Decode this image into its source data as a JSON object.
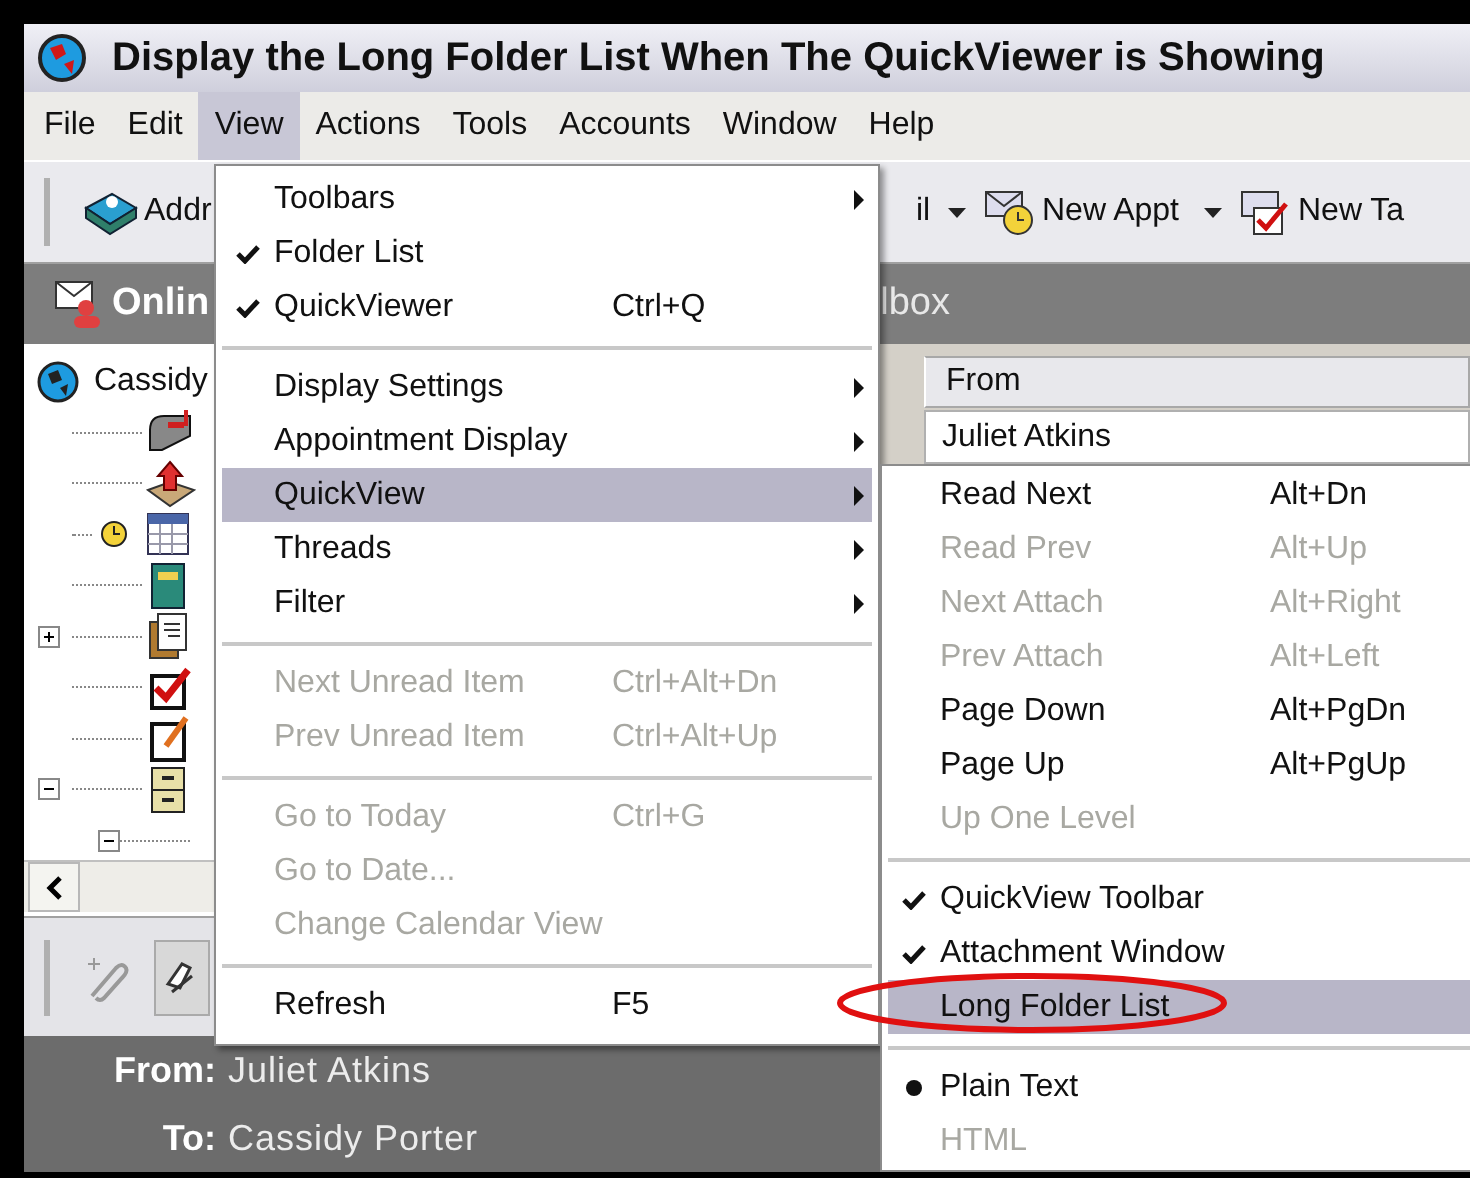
{
  "window": {
    "title": "Display the Long Folder List When The QuickViewer is Showing"
  },
  "menu_bar": [
    {
      "label": "File",
      "selected": false
    },
    {
      "label": "Edit",
      "selected": false
    },
    {
      "label": "View",
      "selected": true
    },
    {
      "label": "Actions",
      "selected": false
    },
    {
      "label": "Tools",
      "selected": false
    },
    {
      "label": "Accounts",
      "selected": false
    },
    {
      "label": "Window",
      "selected": false
    },
    {
      "label": "Help",
      "selected": false
    }
  ],
  "toolbar": [
    {
      "kind": "address",
      "label": "Addr"
    },
    {
      "kind": "mail",
      "label": "il"
    },
    {
      "kind": "appointment",
      "label": "New Appt"
    },
    {
      "kind": "task",
      "label": "New Ta"
    }
  ],
  "panel_header": {
    "title": "Onlin",
    "subtitle": "lbox"
  },
  "folder_tree": {
    "root": "Cassidy",
    "children": [
      {
        "kind": "mailbox"
      },
      {
        "kind": "outbox"
      },
      {
        "kind": "calendar"
      },
      {
        "kind": "notebook"
      },
      {
        "kind": "document",
        "expanded": false
      },
      {
        "kind": "checklist"
      },
      {
        "kind": "note"
      },
      {
        "kind": "cabinet",
        "expanded": true,
        "children": [
          {
            "expanded": true
          }
        ]
      }
    ]
  },
  "message_list": {
    "columns": [
      "From"
    ],
    "rows": [
      [
        "Juliet Atkins"
      ]
    ]
  },
  "view_menu": [
    {
      "kind": "submenu",
      "label": "Toolbars",
      "disabled": false,
      "selected": false
    },
    {
      "kind": "check",
      "label": "Folder List",
      "checked": true,
      "disabled": false,
      "selected": false
    },
    {
      "kind": "check",
      "label": "QuickViewer",
      "shortcut": "Ctrl+Q",
      "checked": true,
      "disabled": false,
      "selected": false
    },
    {
      "kind": "separator"
    },
    {
      "kind": "submenu",
      "label": "Display Settings",
      "disabled": false,
      "selected": false
    },
    {
      "kind": "submenu",
      "label": "Appointment Display",
      "disabled": false,
      "selected": false
    },
    {
      "kind": "submenu",
      "label": "QuickView",
      "disabled": false,
      "selected": true
    },
    {
      "kind": "submenu",
      "label": "Threads",
      "disabled": false,
      "selected": false
    },
    {
      "kind": "submenu",
      "label": "Filter",
      "disabled": false,
      "selected": false
    },
    {
      "kind": "separator"
    },
    {
      "kind": "command",
      "label": "Next Unread Item",
      "shortcut": "Ctrl+Alt+Dn",
      "disabled": true,
      "selected": false
    },
    {
      "kind": "command",
      "label": "Prev Unread Item",
      "shortcut": "Ctrl+Alt+Up",
      "disabled": true,
      "selected": false
    },
    {
      "kind": "separator"
    },
    {
      "kind": "command",
      "label": "Go to Today",
      "shortcut": "Ctrl+G",
      "disabled": true,
      "selected": false
    },
    {
      "kind": "command",
      "label": "Go to Date...",
      "disabled": true,
      "selected": false
    },
    {
      "kind": "command",
      "label": "Change Calendar View",
      "disabled": true,
      "selected": false
    },
    {
      "kind": "separator"
    },
    {
      "kind": "command",
      "label": "Refresh",
      "shortcut": "F5",
      "disabled": false,
      "selected": false
    }
  ],
  "quickview_submenu": [
    {
      "kind": "command",
      "label": "Read Next",
      "shortcut": "Alt+Dn",
      "disabled": false,
      "selected": false
    },
    {
      "kind": "command",
      "label": "Read Prev",
      "shortcut": "Alt+Up",
      "disabled": true,
      "selected": false
    },
    {
      "kind": "command",
      "label": "Next Attach",
      "shortcut": "Alt+Right",
      "disabled": true,
      "selected": false
    },
    {
      "kind": "command",
      "label": "Prev Attach",
      "shortcut": "Alt+Left",
      "disabled": true,
      "selected": false
    },
    {
      "kind": "command",
      "label": "Page Down",
      "shortcut": "Alt+PgDn",
      "disabled": false,
      "selected": false
    },
    {
      "kind": "command",
      "label": "Page Up",
      "shortcut": "Alt+PgUp",
      "disabled": false,
      "selected": false
    },
    {
      "kind": "command",
      "label": "Up One Level",
      "disabled": true,
      "selected": false
    },
    {
      "kind": "separator"
    },
    {
      "kind": "check",
      "label": "QuickView Toolbar",
      "checked": true,
      "disabled": false,
      "selected": false
    },
    {
      "kind": "check",
      "label": "Attachment Window",
      "checked": true,
      "disabled": false,
      "selected": false
    },
    {
      "kind": "check",
      "label": "Long Folder List",
      "checked": false,
      "disabled": false,
      "selected": true
    },
    {
      "kind": "separator"
    },
    {
      "kind": "radio",
      "label": "Plain Text",
      "checked": true,
      "disabled": false,
      "selected": false
    },
    {
      "kind": "radio",
      "label": "HTML",
      "checked": false,
      "disabled": true,
      "selected": false
    }
  ],
  "reading_pane": [
    {
      "label": "From:",
      "value": "Juliet Atkins"
    },
    {
      "label": "To:",
      "value": "Cassidy Porter"
    }
  ]
}
